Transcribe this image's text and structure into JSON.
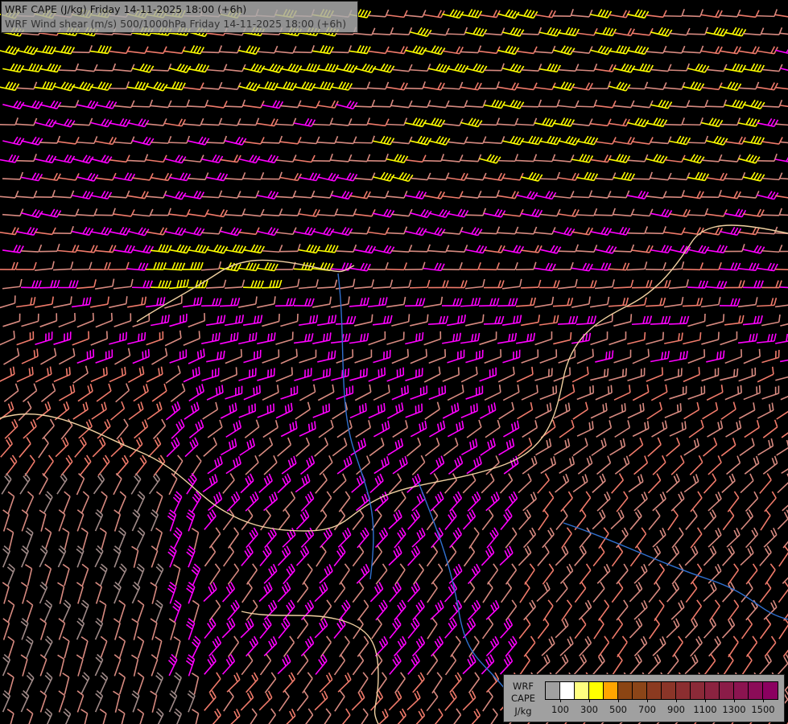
{
  "header": {
    "line1": "WRF CAPE (J/kg) Friday 14-11-2025 18:00 (+6h)",
    "line2": "WRF Wind shear (m/s) 500/1000hPa Friday 14-11-2025 18:00 (+6h)"
  },
  "legend": {
    "label_lines": [
      "WRF",
      "CAPE",
      "J/kg"
    ],
    "colors": [
      "#a0a0a0",
      "#ffffff",
      "#ffff80",
      "#ffff00",
      "#ffa500",
      "#8b4513",
      "#8b4518",
      "#8b3a20",
      "#8b3528",
      "#8b2e30",
      "#8b2a38",
      "#8b2340",
      "#8b1c48",
      "#8b1450",
      "#8b0c58",
      "#8b0060"
    ],
    "tick_labels": [
      "100",
      "300",
      "500",
      "700",
      "900",
      "1100",
      "1300",
      "1500"
    ]
  },
  "barb_colors": {
    "yellow": "#ffff00",
    "magenta": "#ff00ff",
    "salmon": "#f07a6a",
    "pink": "#d88a80",
    "gray": "#a08a88"
  },
  "map_colors": {
    "border": "#f0d0a0",
    "river": "#3070d0"
  }
}
